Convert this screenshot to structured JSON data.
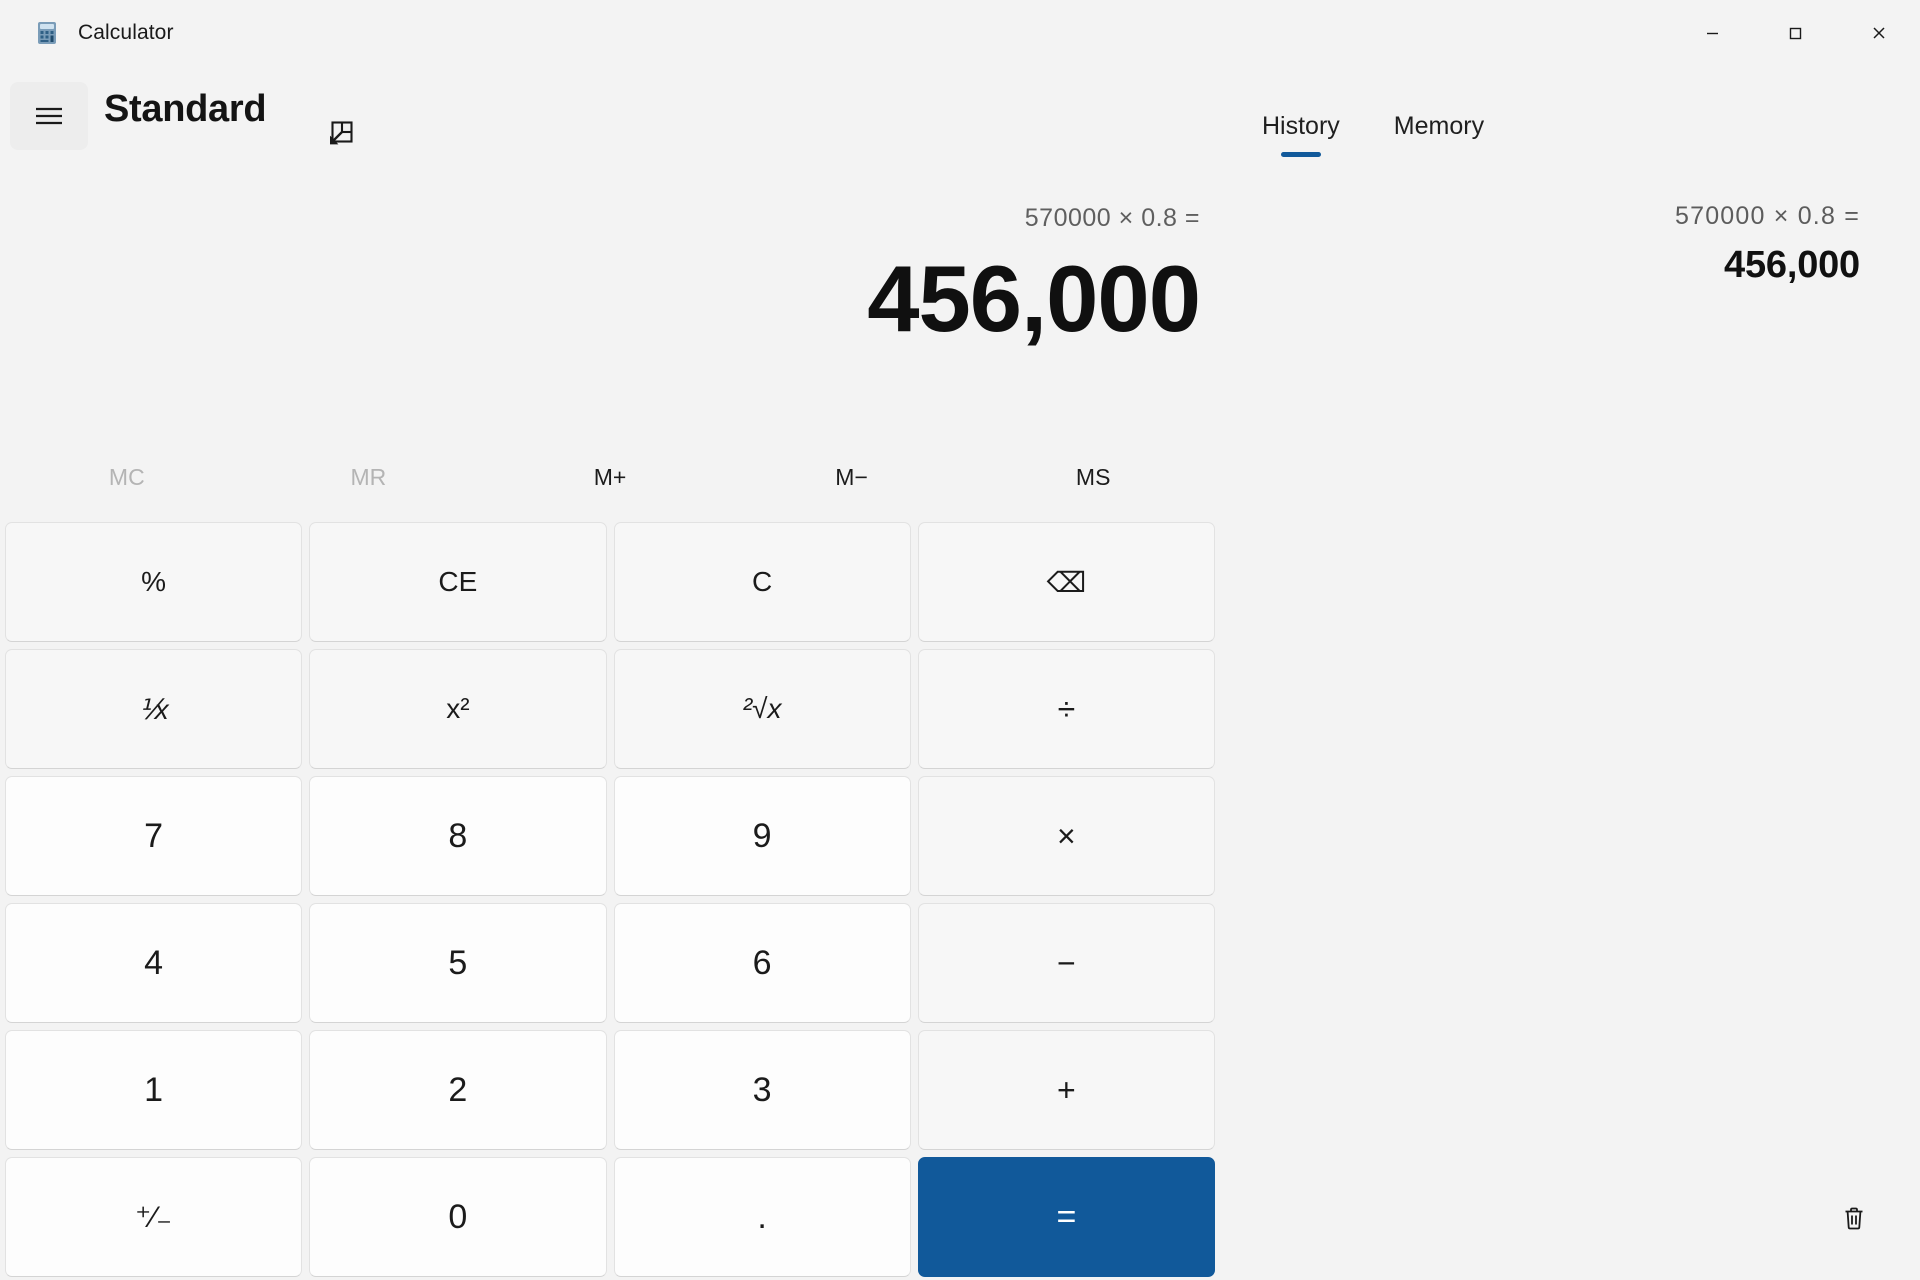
{
  "window": {
    "title": "Calculator",
    "app_icon": "calculator-icon",
    "controls": {
      "minimize": "minimize-icon",
      "maximize": "maximize-icon",
      "close": "close-icon"
    }
  },
  "header": {
    "menu_icon": "hamburger-menu-icon",
    "mode_title": "Standard",
    "keep_on_top_icon": "keep-on-top-icon"
  },
  "panel": {
    "tabs": [
      {
        "label": "History",
        "selected": true
      },
      {
        "label": "Memory",
        "selected": false
      }
    ],
    "clear_history_icon": "trash-icon"
  },
  "display": {
    "expression": "570000 × 0.8 =",
    "result": "456,000"
  },
  "memory_buttons": [
    {
      "label": "MC",
      "name": "memory-clear-button",
      "disabled": true
    },
    {
      "label": "MR",
      "name": "memory-recall-button",
      "disabled": true
    },
    {
      "label": "M+",
      "name": "memory-add-button",
      "disabled": false
    },
    {
      "label": "M−",
      "name": "memory-subtract-button",
      "disabled": false
    },
    {
      "label": "MS",
      "name": "memory-store-button",
      "disabled": false
    }
  ],
  "keypad": [
    {
      "label": "%",
      "name": "percent-button",
      "style": "fn"
    },
    {
      "label": "CE",
      "name": "clear-entry-button",
      "style": "fn"
    },
    {
      "label": "C",
      "name": "clear-button",
      "style": "fn"
    },
    {
      "label": "⌫",
      "name": "backspace-icon-button",
      "style": "fn"
    },
    {
      "label": "⅟x",
      "name": "reciprocal-button",
      "style": "fn"
    },
    {
      "label": "x²",
      "name": "square-button",
      "style": "fn"
    },
    {
      "label": "²√x",
      "name": "square-root-button",
      "style": "fn"
    },
    {
      "label": "÷",
      "name": "divide-button",
      "style": "op"
    },
    {
      "label": "7",
      "name": "digit-7-button",
      "style": "num"
    },
    {
      "label": "8",
      "name": "digit-8-button",
      "style": "num"
    },
    {
      "label": "9",
      "name": "digit-9-button",
      "style": "num"
    },
    {
      "label": "×",
      "name": "multiply-button",
      "style": "op"
    },
    {
      "label": "4",
      "name": "digit-4-button",
      "style": "num"
    },
    {
      "label": "5",
      "name": "digit-5-button",
      "style": "num"
    },
    {
      "label": "6",
      "name": "digit-6-button",
      "style": "num"
    },
    {
      "label": "−",
      "name": "subtract-button",
      "style": "op"
    },
    {
      "label": "1",
      "name": "digit-1-button",
      "style": "num"
    },
    {
      "label": "2",
      "name": "digit-2-button",
      "style": "num"
    },
    {
      "label": "3",
      "name": "digit-3-button",
      "style": "num"
    },
    {
      "label": "+",
      "name": "add-button",
      "style": "op"
    },
    {
      "label": "⁺⁄₋",
      "name": "sign-toggle-button",
      "style": "num"
    },
    {
      "label": "0",
      "name": "digit-0-button",
      "style": "num"
    },
    {
      "label": ".",
      "name": "decimal-point-button",
      "style": "num"
    },
    {
      "label": "=",
      "name": "equals-button",
      "style": "equals"
    }
  ],
  "history_items": [
    {
      "expression": "570000   ×   0.8 =",
      "result": "456,000"
    }
  ],
  "colors": {
    "accent": "#11599a",
    "window_bg": "#f3f3f3",
    "key_bg": "#fdfdfd",
    "key_fn_bg": "#f7f7f7",
    "text": "#1b1b1b",
    "muted_text": "#5f5f5f",
    "disabled_text": "#b4b4b4"
  }
}
